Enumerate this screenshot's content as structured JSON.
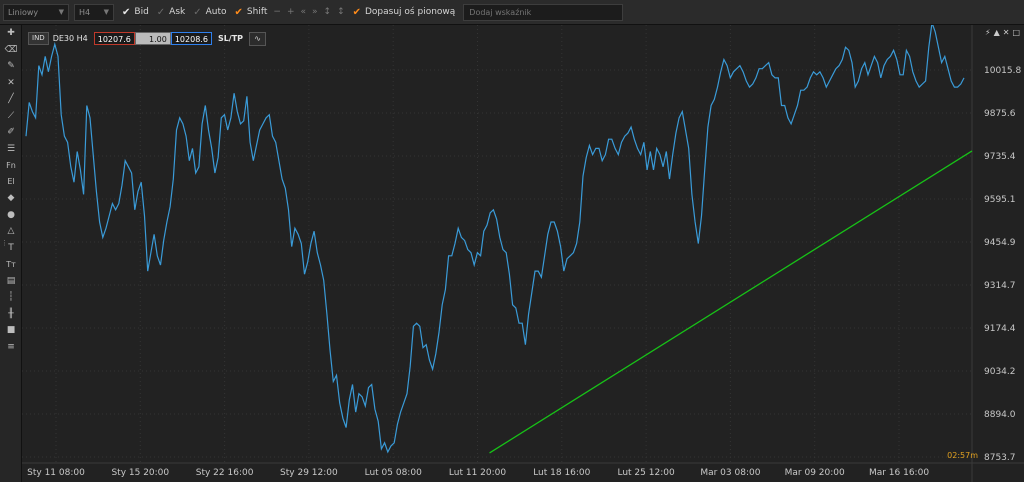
{
  "toolbar": {
    "chart_type": "Liniowy",
    "timeframe": "H4",
    "opt_bid": "Bid",
    "opt_ask": "Ask",
    "opt_auto": "Auto",
    "opt_shift": "Shift",
    "opt_fit": "Dopasuj oś pionową",
    "add_indicator_placeholder": "Dodaj wskaźnik"
  },
  "instrument": {
    "tag": "IND",
    "name": "DE30 H4",
    "bid": "10207.6",
    "quantity": "1.00",
    "ask": "10208.6",
    "sltp": "SL/TP"
  },
  "timer": "02:57m",
  "colors": {
    "price_line": "#3a9bd8",
    "trend_line": "#17c317",
    "grid": "#343434",
    "background": "#222222"
  },
  "chart_data": {
    "type": "line",
    "price_axis_ticks": [
      "10015.8",
      "9875.6",
      "9735.4",
      "9595.1",
      "9454.9",
      "9314.7",
      "9174.4",
      "9034.2",
      "8894.0",
      "8753.7"
    ],
    "time_axis_ticks": [
      "Sty 11 08:00",
      "Sty 15 20:00",
      "Sty 22 16:00",
      "Sty 29 12:00",
      "Lut 05 08:00",
      "Lut 11 20:00",
      "Lut 18 16:00",
      "Lut 25 12:00",
      "Mar 03 08:00",
      "Mar 09 20:00",
      "Mar 16 16:00"
    ],
    "ylim": [
      8740,
      10100
    ],
    "values": [
      9800,
      9910,
      9880,
      9860,
      10030,
      10000,
      10060,
      10010,
      10060,
      10100,
      10060,
      9870,
      9800,
      9780,
      9700,
      9650,
      9750,
      9690,
      9610,
      9900,
      9860,
      9740,
      9620,
      9520,
      9470,
      9500,
      9540,
      9580,
      9560,
      9580,
      9640,
      9720,
      9700,
      9680,
      9560,
      9620,
      9650,
      9540,
      9360,
      9420,
      9480,
      9410,
      9380,
      9460,
      9520,
      9570,
      9660,
      9820,
      9860,
      9840,
      9800,
      9720,
      9760,
      9680,
      9700,
      9840,
      9900,
      9820,
      9760,
      9680,
      9730,
      9860,
      9870,
      9820,
      9860,
      9940,
      9880,
      9840,
      9850,
      9930,
      9780,
      9720,
      9770,
      9820,
      9840,
      9860,
      9870,
      9800,
      9780,
      9720,
      9660,
      9630,
      9560,
      9440,
      9500,
      9480,
      9450,
      9350,
      9390,
      9450,
      9490,
      9420,
      9380,
      9330,
      9220,
      9100,
      9000,
      9020,
      8930,
      8880,
      8850,
      8940,
      8990,
      8900,
      8960,
      8950,
      8920,
      8980,
      8990,
      8910,
      8870,
      8780,
      8800,
      8770,
      8790,
      8800,
      8860,
      8900,
      8930,
      8960,
      9050,
      9180,
      9190,
      9180,
      9110,
      9120,
      9070,
      9040,
      9090,
      9160,
      9250,
      9300,
      9410,
      9410,
      9450,
      9500,
      9470,
      9460,
      9430,
      9420,
      9380,
      9420,
      9410,
      9490,
      9510,
      9550,
      9560,
      9530,
      9470,
      9430,
      9420,
      9350,
      9250,
      9240,
      9190,
      9190,
      9120,
      9220,
      9290,
      9360,
      9360,
      9340,
      9410,
      9480,
      9520,
      9520,
      9490,
      9440,
      9360,
      9400,
      9410,
      9420,
      9450,
      9520,
      9670,
      9730,
      9770,
      9740,
      9760,
      9760,
      9720,
      9740,
      9790,
      9790,
      9760,
      9740,
      9780,
      9800,
      9810,
      9830,
      9790,
      9760,
      9740,
      9780,
      9690,
      9750,
      9690,
      9760,
      9740,
      9700,
      9750,
      9660,
      9740,
      9810,
      9860,
      9880,
      9820,
      9760,
      9610,
      9520,
      9450,
      9540,
      9690,
      9830,
      9900,
      9920,
      9960,
      10010,
      10050,
      10030,
      9990,
      10010,
      10020,
      10030,
      10010,
      9980,
      9960,
      9970,
      9990,
      10020,
      10020,
      10030,
      10040,
      10000,
      9990,
      9990,
      9900,
      9900,
      9860,
      9840,
      9870,
      9900,
      9950,
      9950,
      9960,
      9990,
      10010,
      10000,
      10010,
      9990,
      9960,
      9980,
      10000,
      10020,
      10030,
      10050,
      10090,
      10080,
      10040,
      9960,
      9980,
      10020,
      10040,
      10000,
      10030,
      10060,
      10040,
      9990,
      10030,
      10050,
      10060,
      10080,
      10050,
      10000,
      10000,
      10080,
      10060,
      10010,
      9980,
      9960,
      9970,
      9980,
      10090,
      10170,
      10140,
      10090,
      10040,
      10060,
      10020,
      9980,
      9960,
      9960,
      9970,
      9990
    ],
    "trend_line": {
      "from": [
        0.49,
        8767
      ],
      "to": [
        1.0,
        9752
      ]
    },
    "grid": true
  }
}
